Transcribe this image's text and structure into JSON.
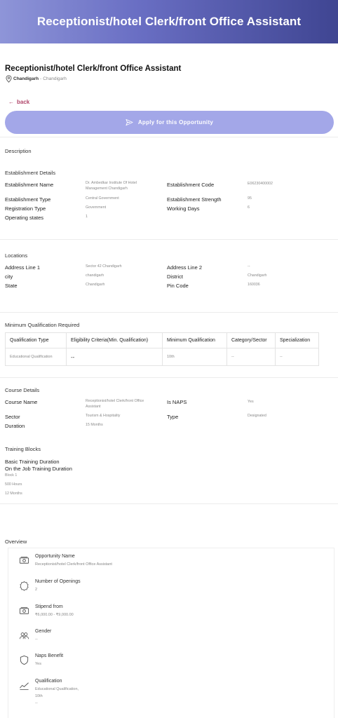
{
  "header": {
    "title": "Receptionist/hotel Clerk/front Office Assistant"
  },
  "job": {
    "title": "Receptionist/hotel Clerk/front Office Assistant",
    "location_city": "Chandigarh",
    "location_sep": " - ",
    "location_state": "Chandigarh"
  },
  "actions": {
    "back_label": "back",
    "apply_label": "Apply for this Opportunity"
  },
  "description": {
    "heading": "Description"
  },
  "establishment": {
    "heading": "Establishment Details",
    "name_label": "Establishment Name",
    "name_value_line1": "Dr. Ambedkar Institute Of Hotel",
    "name_value_line2": "Management Chandigarh",
    "code_label": "Establishment Code",
    "code_value": "E06230400002",
    "type_label": "Establishment Type",
    "type_value": "Central Government",
    "strength_label": "Establishment Strength",
    "strength_value": "95",
    "reg_label": "Registration Type",
    "reg_value": "Government",
    "days_label": "Working Days",
    "days_value": "6",
    "states_label": "Operating states",
    "states_value": "1"
  },
  "locations": {
    "heading": "Locations",
    "addr1_label": "Address Line 1",
    "addr1_value": "Sector 42 Chandigarh",
    "addr2_label": "Address Line 2",
    "addr2_value": "--",
    "city_label": "city",
    "city_value": "chandigarh",
    "district_label": "District",
    "district_value": "Chandigarh",
    "state_label": "State",
    "state_value": "Chandigarh",
    "pin_label": "Pin Code",
    "pin_value": "160036"
  },
  "min_qual": {
    "heading": "Minimum Qualification Required",
    "headers": [
      "Qualification Type",
      "Eligibility Criteria(Min. Qualification)",
      "Minimum Qualification",
      "Category/Sector",
      "Specialization"
    ],
    "row": [
      "Educational Qualification",
      "--",
      "10th",
      "--",
      "--"
    ]
  },
  "course": {
    "heading": "Course Details",
    "name_label": "Course Name",
    "name_value_line1": "Receptionist/hotel Clerk/front Office",
    "name_value_line2": "Assistant",
    "naps_label": "Is NAPS",
    "naps_value": "Yes",
    "sector_label": "Sector",
    "sector_value": "Tourism & Hospitality",
    "type_label": "Type",
    "type_value": "Designated",
    "duration_label": "Duration",
    "duration_value": "15 Months"
  },
  "training": {
    "heading": "Training Blocks",
    "basic_label": "Basic Training Duration",
    "ojt_label": "On the Job Training Duration",
    "block_label": "Block 1",
    "hours_value": "500 Hours",
    "months_value": "12 Months"
  },
  "overview": {
    "heading": "Overview",
    "items": [
      {
        "title": "Opportunity Name",
        "value": "Receptionist/hotel Clerk/front Office Assistant",
        "icon": "cash-icon"
      },
      {
        "title": "Number of Openings",
        "value": "2",
        "icon": "badge-icon"
      },
      {
        "title": "Stipend from",
        "value": "₹6,000.00 - ₹9,000.00",
        "icon": "cash-icon"
      },
      {
        "title": "Gender",
        "value": "--",
        "icon": "people-icon"
      },
      {
        "title": "Naps Benefit",
        "value": "Yes",
        "icon": "shield-icon"
      },
      {
        "title": "Qualification",
        "value": "Educational Qualification,",
        "value2": "10th",
        "value3": "--",
        "icon": "chart-icon"
      }
    ]
  }
}
